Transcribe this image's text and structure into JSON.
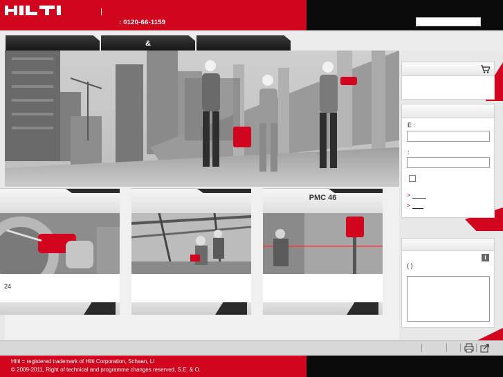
{
  "header": {
    "brand": "HILTI",
    "phone": ":  0120-66-1159",
    "search_placeholder": ""
  },
  "nav": {
    "tabs": [
      "",
      "&",
      ""
    ]
  },
  "cards": [
    {
      "title": "",
      "text": "24"
    },
    {
      "title": "",
      "text": ""
    },
    {
      "title": "PMC 46",
      "text": ""
    }
  ],
  "sidebar": {
    "cart": {
      "icon": "cart-icon"
    },
    "login": {
      "email_label": "E     :",
      "password_label": "  :",
      "links": [
        ">",
        ">"
      ]
    },
    "info": {
      "paren_label": "(   )",
      "icon": "info-icon"
    }
  },
  "footer": {
    "line1": "Hilti = registered trademark of Hilti Corporation, Schaan, LI",
    "line2": "© 2009-2011, Right of technical and programme changes reserved, S.E. & O."
  },
  "colors": {
    "brand_red": "#d2051e",
    "black": "#0b0b0b"
  }
}
